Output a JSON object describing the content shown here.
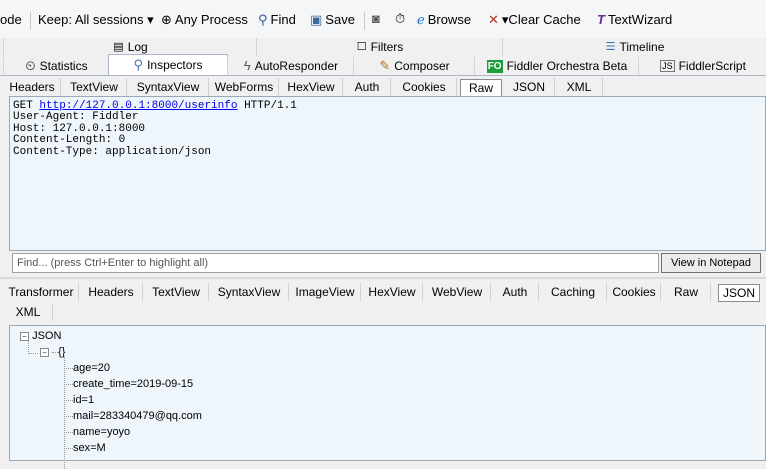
{
  "toolbar": {
    "items": [
      {
        "label": "ode"
      },
      {
        "label": "Keep: All sessions ▾"
      },
      {
        "icon": "crosshair-icon",
        "label": "Any Process"
      },
      {
        "icon": "binoculars-icon",
        "label": "Find"
      },
      {
        "icon": "save-icon",
        "label": "Save"
      },
      {
        "icon": "camera-icon",
        "label": ""
      },
      {
        "icon": "timer-icon",
        "label": ""
      },
      {
        "icon": "browser-icon",
        "label": "Browse"
      },
      {
        "icon": "clear-cache-icon",
        "label": "▾Clear Cache"
      },
      {
        "icon": "text-wizard-icon",
        "label": "TextWizard"
      }
    ]
  },
  "main_tabs_row1": [
    {
      "icon": "log-icon",
      "label": "Log"
    },
    {
      "icon": "filter-icon",
      "label": "Filters"
    },
    {
      "icon": "timeline-icon",
      "label": "Timeline"
    }
  ],
  "main_tabs_row2": [
    {
      "icon": "statistics-icon",
      "label": "Statistics"
    },
    {
      "icon": "inspectors-icon",
      "label": "Inspectors",
      "active": true
    },
    {
      "icon": "autoresponder-icon",
      "label": "AutoResponder"
    },
    {
      "icon": "composer-icon",
      "label": "Composer"
    },
    {
      "icon": "fo-icon",
      "label": "Fiddler Orchestra Beta"
    },
    {
      "icon": "fiddlerscript-icon",
      "label": "FiddlerScript"
    }
  ],
  "request": {
    "tabs": [
      "Headers",
      "TextView",
      "SyntaxView",
      "WebForms",
      "HexView",
      "Auth",
      "Cookies",
      "Raw",
      "JSON",
      "XML"
    ],
    "selected_tab": "Raw",
    "raw": {
      "method": "GET",
      "url": "http://127.0.0.1:8000/userinfo",
      "protocol": "HTTP/1.1",
      "headers": [
        "User-Agent: Fiddler",
        "Host: 127.0.0.1:8000",
        "Content-Length: 0",
        "Content-Type: application/json"
      ]
    },
    "find_placeholder": "Find... (press Ctrl+Enter to highlight all)",
    "notepad_button": "View in Notepad"
  },
  "response": {
    "tabs": [
      "Transformer",
      "Headers",
      "TextView",
      "SyntaxView",
      "ImageView",
      "HexView",
      "WebView",
      "Auth",
      "Caching",
      "Cookies",
      "Raw",
      "JSON"
    ],
    "tabs_row2": [
      "XML"
    ],
    "selected_tab": "JSON",
    "tree": {
      "root": "JSON",
      "object": "{}",
      "fields": [
        "age=20",
        "create_time=2019-09-15",
        "id=1",
        "mail=283340479@qq.com",
        "name=yoyo",
        "sex=M"
      ]
    }
  },
  "colors": {
    "pane_bg": "#eef5fb",
    "link": "#0000ee",
    "fo_badge": "#1e9e3a"
  }
}
